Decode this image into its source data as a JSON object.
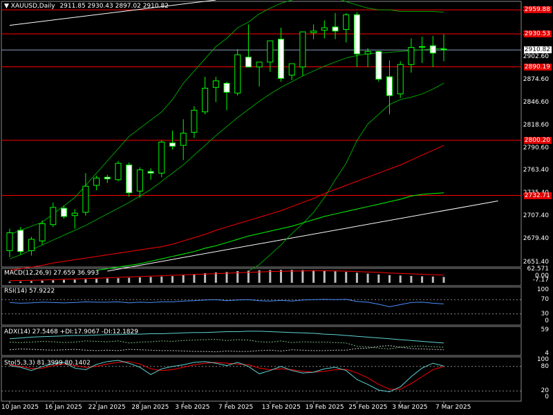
{
  "header": {
    "symbol": "XAUUSD,Daily",
    "ohlc": "2911.85 2930.43 2897.02 2910.82"
  },
  "colors": {
    "background": "#000000",
    "bull": "#00ff00",
    "ma_fast": "#00a000",
    "ma_red": "#ff0000",
    "ma_green": "#00ff00",
    "trendline": "#ffffff",
    "hline": "#ff0000",
    "rsi": "#4a8fff",
    "stoch_main": "#5fd3d3",
    "stoch_signal": "#ff0000"
  },
  "chart_data": [
    {
      "type": "candlestick",
      "name": "main",
      "ylim": [
        2640,
        2972
      ],
      "y_ticks": [
        "2959.88",
        "2930.53",
        "2902.60",
        "2874.60",
        "2846.60",
        "2818.60",
        "2790.60",
        "2763.40",
        "2735.40",
        "2707.40",
        "2679.40",
        "2651.40"
      ],
      "current_price": "2910.82",
      "x_tick_labels": [
        "10 Jan 2025",
        "16 Jan 2025",
        "22 Jan 2025",
        "28 Jan 2025",
        "3 Feb 2025",
        "7 Feb 2025",
        "13 Feb 2025",
        "19 Feb 2025",
        "25 Feb 2025",
        "3 Mar 2025",
        "7 Mar 2025"
      ],
      "x_tick_index": [
        0,
        4,
        8,
        12,
        16,
        20,
        24,
        28,
        32,
        36,
        40
      ],
      "horizontal_levels": [
        {
          "value": 2959.88,
          "label": "2959.88"
        },
        {
          "value": 2930.53,
          "label": "2930.53"
        },
        {
          "value": 2890.19,
          "label": "2890.19"
        },
        {
          "value": 2800.2,
          "label": "2800.20"
        },
        {
          "value": 2732.71,
          "label": "2732.71"
        }
      ],
      "candles": [
        {
          "o": 2665,
          "h": 2692,
          "l": 2657,
          "c": 2687
        },
        {
          "o": 2690,
          "h": 2694,
          "l": 2660,
          "c": 2664
        },
        {
          "o": 2665,
          "h": 2682,
          "l": 2659,
          "c": 2679
        },
        {
          "o": 2677,
          "h": 2702,
          "l": 2672,
          "c": 2698
        },
        {
          "o": 2697,
          "h": 2724,
          "l": 2694,
          "c": 2718
        },
        {
          "o": 2717,
          "h": 2720,
          "l": 2704,
          "c": 2707
        },
        {
          "o": 2708,
          "h": 2716,
          "l": 2692,
          "c": 2711
        },
        {
          "o": 2712,
          "h": 2760,
          "l": 2708,
          "c": 2744
        },
        {
          "o": 2745,
          "h": 2757,
          "l": 2739,
          "c": 2754
        },
        {
          "o": 2755,
          "h": 2758,
          "l": 2748,
          "c": 2753
        },
        {
          "o": 2752,
          "h": 2775,
          "l": 2750,
          "c": 2772
        },
        {
          "o": 2770,
          "h": 2773,
          "l": 2731,
          "c": 2736
        },
        {
          "o": 2738,
          "h": 2767,
          "l": 2730,
          "c": 2764
        },
        {
          "o": 2762,
          "h": 2766,
          "l": 2752,
          "c": 2760
        },
        {
          "o": 2760,
          "h": 2800,
          "l": 2755,
          "c": 2798
        },
        {
          "o": 2797,
          "h": 2812,
          "l": 2789,
          "c": 2793
        },
        {
          "o": 2794,
          "h": 2826,
          "l": 2776,
          "c": 2809
        },
        {
          "o": 2810,
          "h": 2842,
          "l": 2803,
          "c": 2837
        },
        {
          "o": 2835,
          "h": 2878,
          "l": 2832,
          "c": 2864
        },
        {
          "o": 2865,
          "h": 2878,
          "l": 2847,
          "c": 2873
        },
        {
          "o": 2870,
          "h": 2872,
          "l": 2837,
          "c": 2859
        },
        {
          "o": 2858,
          "h": 2912,
          "l": 2855,
          "c": 2905
        },
        {
          "o": 2902,
          "h": 2942,
          "l": 2890,
          "c": 2890
        },
        {
          "o": 2890,
          "h": 2895,
          "l": 2866,
          "c": 2896
        },
        {
          "o": 2896,
          "h": 2922,
          "l": 2884,
          "c": 2922
        },
        {
          "o": 2924,
          "h": 2938,
          "l": 2872,
          "c": 2876
        },
        {
          "o": 2880,
          "h": 2886,
          "l": 2874,
          "c": 2894
        },
        {
          "o": 2890,
          "h": 2931,
          "l": 2879,
          "c": 2933
        },
        {
          "o": 2932,
          "h": 2942,
          "l": 2924,
          "c": 2934
        },
        {
          "o": 2935,
          "h": 2947,
          "l": 2925,
          "c": 2938
        },
        {
          "o": 2939,
          "h": 2956,
          "l": 2924,
          "c": 2934
        },
        {
          "o": 2936,
          "h": 2956,
          "l": 2920,
          "c": 2954
        },
        {
          "o": 2954,
          "h": 2957,
          "l": 2890,
          "c": 2906
        },
        {
          "o": 2906,
          "h": 2913,
          "l": 2890,
          "c": 2909
        },
        {
          "o": 2909,
          "h": 2910,
          "l": 2872,
          "c": 2875
        },
        {
          "o": 2878,
          "h": 2898,
          "l": 2832,
          "c": 2855
        },
        {
          "o": 2857,
          "h": 2897,
          "l": 2852,
          "c": 2893
        },
        {
          "o": 2893,
          "h": 2925,
          "l": 2883,
          "c": 2914
        },
        {
          "o": 2915,
          "h": 2927,
          "l": 2895,
          "c": 2915
        },
        {
          "o": 2916,
          "h": 2928,
          "l": 2890,
          "c": 2907
        },
        {
          "o": 2912,
          "h": 2930,
          "l": 2897,
          "c": 2911
        }
      ],
      "ma_red": [
        2641,
        2643,
        2645,
        2647,
        2650,
        2652,
        2654,
        2656,
        2658,
        2660,
        2662,
        2664,
        2666,
        2668,
        2670,
        2673,
        2677,
        2681,
        2685,
        2690,
        2694,
        2698,
        2702,
        2706,
        2710,
        2714,
        2719,
        2724,
        2729,
        2735,
        2740,
        2745,
        2750,
        2755,
        2760,
        2765,
        2770,
        2776,
        2782,
        2788,
        2794
      ],
      "ma_green": [
        null,
        null,
        null,
        null,
        null,
        null,
        null,
        null,
        2641,
        2643,
        2645,
        2647,
        2649,
        2652,
        2655,
        2658,
        2661,
        2664,
        2668,
        2671,
        2675,
        2679,
        2683,
        2686,
        2689,
        2692,
        2695,
        2699,
        2703,
        2707,
        2710,
        2713,
        2716,
        2719,
        2722,
        2725,
        2728,
        2732,
        2734,
        2735,
        2736
      ],
      "ma_fast": [
        2655,
        2660,
        2666,
        2672,
        2678,
        2684,
        2690,
        2696,
        2703,
        2710,
        2717,
        2724,
        2732,
        2740,
        2750,
        2760,
        2770,
        2782,
        2794,
        2806,
        2817,
        2828,
        2838,
        2848,
        2857,
        2865,
        2872,
        2879,
        2885,
        2891,
        2896,
        2901,
        2904,
        2906,
        2907,
        2908,
        2909,
        2910,
        2911,
        2912,
        2913
      ],
      "bb_upper": [
        2685,
        2690,
        2695,
        2700,
        2710,
        2720,
        2730,
        2745,
        2760,
        2775,
        2790,
        2805,
        2815,
        2825,
        2835,
        2850,
        2870,
        2885,
        2900,
        2915,
        2925,
        2938,
        2945,
        2955,
        2962,
        2968,
        2972,
        2975,
        2978,
        2980,
        2975,
        2970,
        2966,
        2962,
        2960,
        2960,
        2958,
        2958,
        2958,
        2958,
        2957
      ],
      "bb_lower": [
        null,
        null,
        null,
        null,
        null,
        null,
        null,
        null,
        null,
        null,
        null,
        null,
        null,
        null,
        null,
        null,
        null,
        null,
        null,
        null,
        null,
        null,
        2640,
        2648,
        2660,
        2672,
        2686,
        2698,
        2712,
        2730,
        2752,
        2772,
        2800,
        2820,
        2832,
        2844,
        2850,
        2853,
        2857,
        2863,
        2870
      ],
      "trend_upper": {
        "from_index": 0,
        "from_value": 2941,
        "to_index": 19,
        "to_value": 2972
      },
      "trend_lower": {
        "from_index": 9,
        "from_value": 2640,
        "to_index": 45,
        "to_value": 2726
      }
    },
    {
      "type": "bar",
      "name": "MACD(12,26,9)",
      "title": "MACD(12,26,9) 27.659 36.993",
      "y_ticks": [
        "62.571",
        "0.00",
        "-7.17"
      ],
      "ylim": [
        -7.17,
        62.571
      ],
      "histogram": [
        5,
        6,
        8,
        10,
        12,
        14,
        15,
        17,
        19,
        21,
        22,
        24,
        26,
        28,
        30,
        32,
        36,
        41,
        46,
        50,
        52,
        56,
        58,
        60,
        61,
        62,
        62,
        61,
        60,
        58,
        55,
        52,
        48,
        44,
        40,
        37,
        35,
        33,
        31,
        30,
        28
      ],
      "signal": [
        10,
        11,
        12,
        13,
        15,
        17,
        18,
        20,
        22,
        24,
        26,
        28,
        30,
        32,
        34,
        36,
        38,
        40,
        42,
        44,
        46,
        48,
        50,
        52,
        54,
        55,
        56,
        57,
        58,
        58,
        57,
        56,
        54,
        52,
        50,
        47,
        45,
        43,
        41,
        39,
        37
      ]
    },
    {
      "type": "line",
      "name": "RSI(14)",
      "title": "RSI(14) 57.9222",
      "y_ticks": [
        "100",
        "70",
        "30",
        "0"
      ],
      "ylim": [
        0,
        100
      ],
      "levels": [
        70,
        30
      ],
      "values": [
        62,
        60,
        61,
        63,
        62,
        61,
        62,
        64,
        63,
        63,
        64,
        61,
        63,
        62,
        64,
        64,
        66,
        67,
        69,
        70,
        67,
        69,
        70,
        67,
        66,
        68,
        66,
        69,
        70,
        71,
        70,
        71,
        65,
        63,
        57,
        50,
        56,
        62,
        63,
        60,
        58
      ]
    },
    {
      "type": "line",
      "name": "ADX(14)",
      "title": "ADX(14) 27.5468 +DI:17.9067 -DI:12.1829",
      "y_ticks": [
        "59",
        "4"
      ],
      "ylim": [
        0,
        64
      ],
      "adx": [
        38,
        40,
        42,
        43,
        44,
        45,
        46,
        46,
        47,
        48,
        48,
        49,
        49,
        50,
        50,
        51,
        52,
        53,
        53,
        54,
        55,
        55,
        56,
        56,
        55,
        54,
        53,
        52,
        51,
        49,
        48,
        46,
        44,
        42,
        40,
        38,
        36,
        34,
        32,
        30,
        28
      ],
      "plus_di": [
        30,
        29,
        30,
        32,
        31,
        29,
        30,
        33,
        32,
        31,
        33,
        28,
        30,
        31,
        33,
        32,
        34,
        35,
        36,
        37,
        34,
        36,
        35,
        31,
        30,
        33,
        29,
        31,
        30,
        30,
        29,
        28,
        20,
        19,
        16,
        14,
        18,
        20,
        21,
        19,
        18
      ],
      "minus_di": [
        12,
        14,
        13,
        12,
        11,
        12,
        13,
        11,
        10,
        11,
        10,
        13,
        12,
        11,
        10,
        10,
        9,
        8,
        8,
        7,
        9,
        8,
        8,
        10,
        11,
        9,
        12,
        11,
        10,
        10,
        11,
        11,
        15,
        16,
        20,
        22,
        18,
        15,
        14,
        13,
        12
      ]
    },
    {
      "type": "line",
      "name": "Stoch(5,3,3)",
      "title": "Sto(5,3,3) 81.3999 80.1402",
      "y_ticks": [
        "100",
        "80",
        "20",
        "0"
      ],
      "ylim": [
        0,
        100
      ],
      "levels": [
        80,
        20
      ],
      "main": [
        82,
        78,
        70,
        80,
        86,
        90,
        76,
        72,
        85,
        92,
        95,
        88,
        78,
        60,
        74,
        80,
        84,
        90,
        92,
        88,
        82,
        90,
        80,
        62,
        70,
        80,
        70,
        64,
        66,
        74,
        78,
        70,
        48,
        36,
        22,
        18,
        30,
        55,
        76,
        88,
        81
      ],
      "signal": [
        84,
        80,
        75,
        76,
        82,
        86,
        82,
        78,
        80,
        86,
        90,
        92,
        86,
        74,
        70,
        72,
        78,
        84,
        88,
        90,
        88,
        86,
        84,
        76,
        72,
        74,
        72,
        68,
        66,
        68,
        72,
        73,
        64,
        52,
        36,
        24,
        24,
        38,
        55,
        72,
        80
      ]
    }
  ]
}
